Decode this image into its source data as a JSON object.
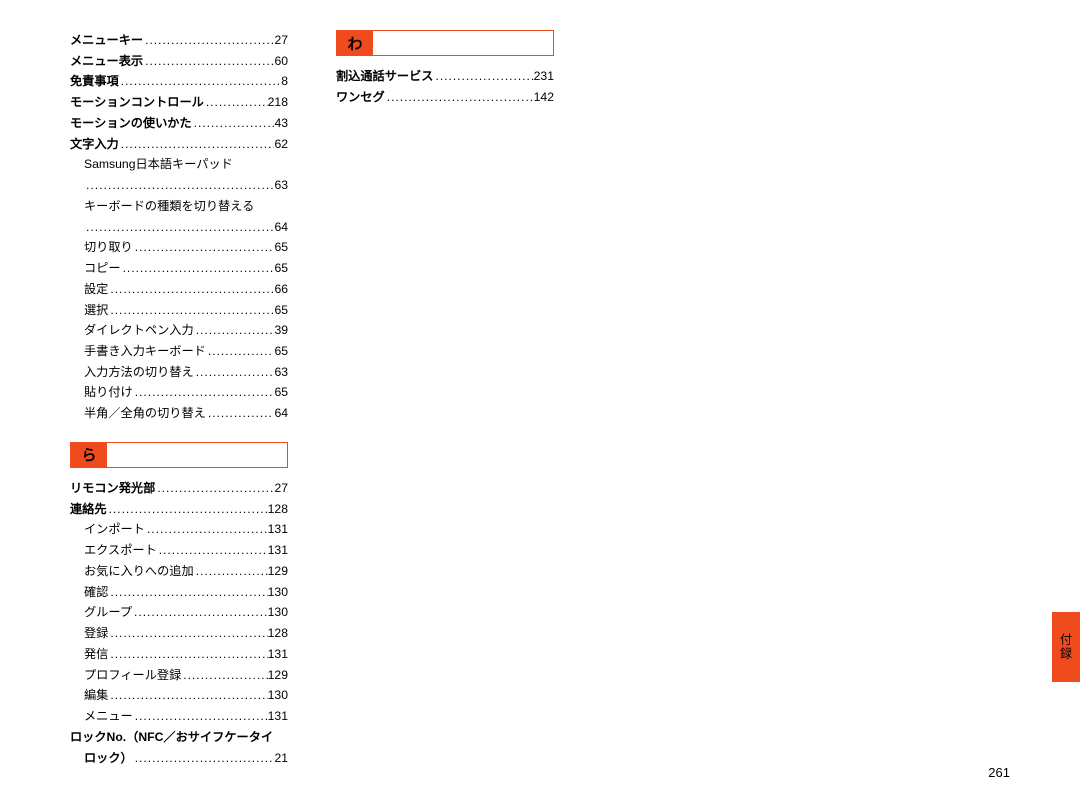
{
  "page_number": "261",
  "side_tab": "付録",
  "sections": {
    "ra_heading": "ら",
    "wa_heading": "わ"
  },
  "col1_top": [
    {
      "label": "メニューキー",
      "page": "27",
      "bold": true
    },
    {
      "label": "メニュー表示",
      "page": "60",
      "bold": true
    },
    {
      "label": "免責事項",
      "page": "8",
      "bold": true
    },
    {
      "label": "モーションコントロール",
      "page": "218",
      "bold": true
    },
    {
      "label": "モーションの使いかた",
      "page": "43",
      "bold": true
    },
    {
      "label": "文字入力",
      "page": "62",
      "bold": true
    }
  ],
  "col1_moji_sub_multiline": [
    {
      "label": "Samsung日本語キーパッド",
      "page": "63"
    },
    {
      "label": "キーボードの種類を切り替える",
      "page": "64"
    }
  ],
  "col1_moji_sub": [
    {
      "label": "切り取り",
      "page": "65"
    },
    {
      "label": "コピー",
      "page": "65"
    },
    {
      "label": "設定",
      "page": "66"
    },
    {
      "label": "選択",
      "page": "65"
    },
    {
      "label": "ダイレクトペン入力",
      "page": "39"
    },
    {
      "label": "手書き入力キーボード",
      "page": "65"
    },
    {
      "label": "入力方法の切り替え",
      "page": "63"
    },
    {
      "label": "貼り付け",
      "page": "65"
    },
    {
      "label": "半角／全角の切り替え",
      "page": "64"
    }
  ],
  "col1_ra_top": [
    {
      "label": "リモコン発光部",
      "page": "27",
      "bold": true
    },
    {
      "label": "連絡先",
      "page": "128",
      "bold": true
    }
  ],
  "col1_ra_sub": [
    {
      "label": "インポート",
      "page": "131"
    },
    {
      "label": "エクスポート",
      "page": "131"
    },
    {
      "label": "お気に入りへの追加",
      "page": "129"
    },
    {
      "label": "確認",
      "page": "130"
    },
    {
      "label": "グループ",
      "page": "130"
    },
    {
      "label": "登録",
      "page": "128"
    },
    {
      "label": "発信",
      "page": "131"
    },
    {
      "label": "プロフィール登録",
      "page": "129"
    },
    {
      "label": "編集",
      "page": "130"
    },
    {
      "label": "メニュー",
      "page": "131"
    }
  ],
  "col1_ra_bottom_multiline": {
    "line1": "ロックNo.（NFC／おサイフケータイ",
    "line2_label": "ロック）",
    "page": "21"
  },
  "col2_wa": [
    {
      "label": "割込通話サービス",
      "page": "231",
      "bold": true
    },
    {
      "label": "ワンセグ",
      "page": "142",
      "bold": true
    }
  ]
}
